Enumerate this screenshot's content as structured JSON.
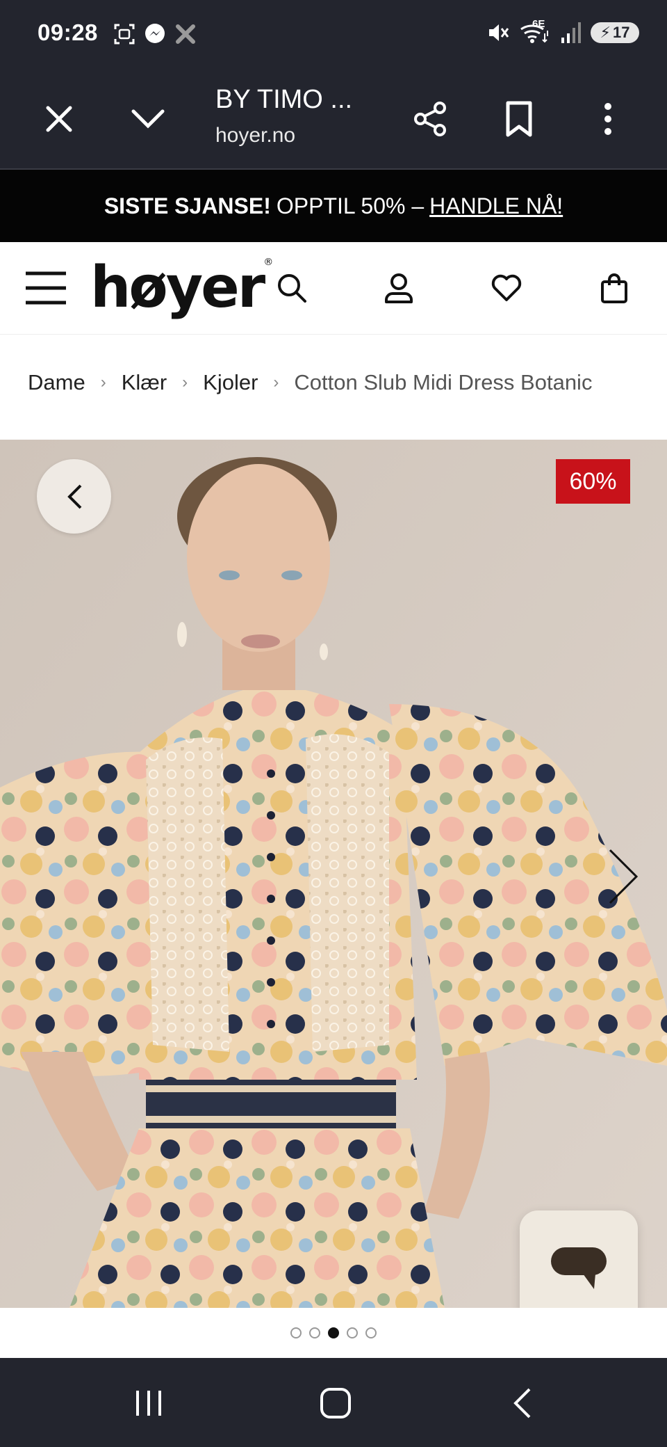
{
  "status_bar": {
    "time": "09:28",
    "network_label": "6E",
    "battery": "17",
    "icons": [
      "screenshot-icon",
      "messenger-icon",
      "app-icon",
      "mute-icon",
      "wifi-icon",
      "signal-icon"
    ]
  },
  "browser": {
    "title": "BY TIMO ...",
    "url": "hoyer.no",
    "icons": [
      "close-icon",
      "chevron-down-icon",
      "share-icon",
      "bookmark-icon",
      "more-icon"
    ]
  },
  "promo": {
    "bold": "SISTE SJANSE!",
    "text": "OPPTIL 50% –",
    "link": "HANDLE NÅ!"
  },
  "header": {
    "logo": "høyer",
    "logo_mark": "®",
    "icons": [
      "menu-icon",
      "search-icon",
      "account-icon",
      "wishlist-icon",
      "cart-icon"
    ]
  },
  "breadcrumb": {
    "items": [
      "Dame",
      "Klær",
      "Kjoler"
    ],
    "current": "Cotton Slub Midi Dress Botanic",
    "separator": "›"
  },
  "product": {
    "discount": "60%",
    "image_count": 5,
    "active_image": 3
  },
  "colors": {
    "system_bar": "#23252e",
    "promo_bg": "#050505",
    "discount_red": "#c8121a",
    "chat_bg": "#efe9df"
  }
}
